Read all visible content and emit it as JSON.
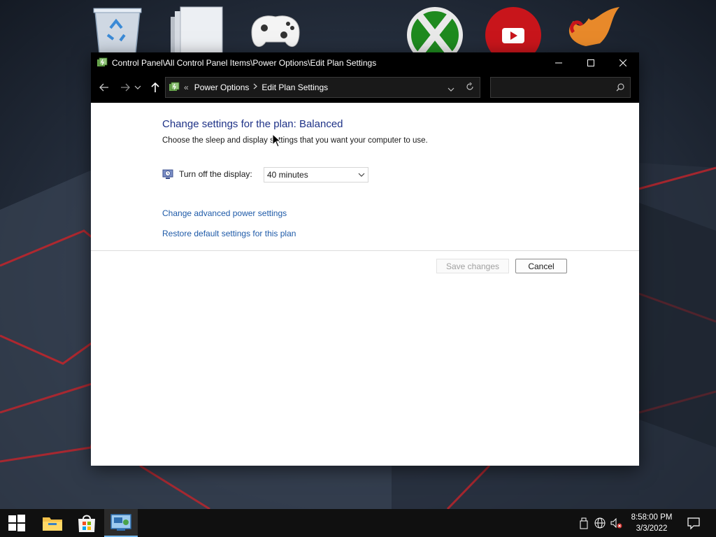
{
  "window": {
    "title": "Control Panel\\All Control Panel Items\\Power Options\\Edit Plan Settings",
    "breadcrumb_overflow": "«",
    "breadcrumbs": [
      "Power Options",
      "Edit Plan Settings"
    ],
    "search_placeholder": ""
  },
  "content": {
    "heading": "Change settings for the plan: Balanced",
    "subtext": "Choose the sleep and display settings that you want your computer to use.",
    "display_label": "Turn off the display:",
    "display_value": "40 minutes",
    "advanced_link": "Change advanced power settings",
    "restore_link": "Restore default settings for this plan",
    "save_button": "Save changes",
    "cancel_button": "Cancel"
  },
  "taskbar": {
    "time": "8:58:00 PM",
    "date": "3/3/2022",
    "pinned": [
      "start-icon",
      "file-explorer-icon",
      "store-icon",
      "control-panel-icon"
    ],
    "active_item": "control-panel-icon"
  },
  "desktop_icons": [
    "recycle-bin-icon",
    "folder-icon",
    "xbox-controller-icon",
    "xbox-icon",
    "youtube-icon",
    "phoenix-app-icon"
  ],
  "colors": {
    "heading": "#1e3287",
    "link": "#1e5aa8",
    "taskbar": "#101010",
    "titlebar": "#000000",
    "accent": "#76b9ed"
  }
}
